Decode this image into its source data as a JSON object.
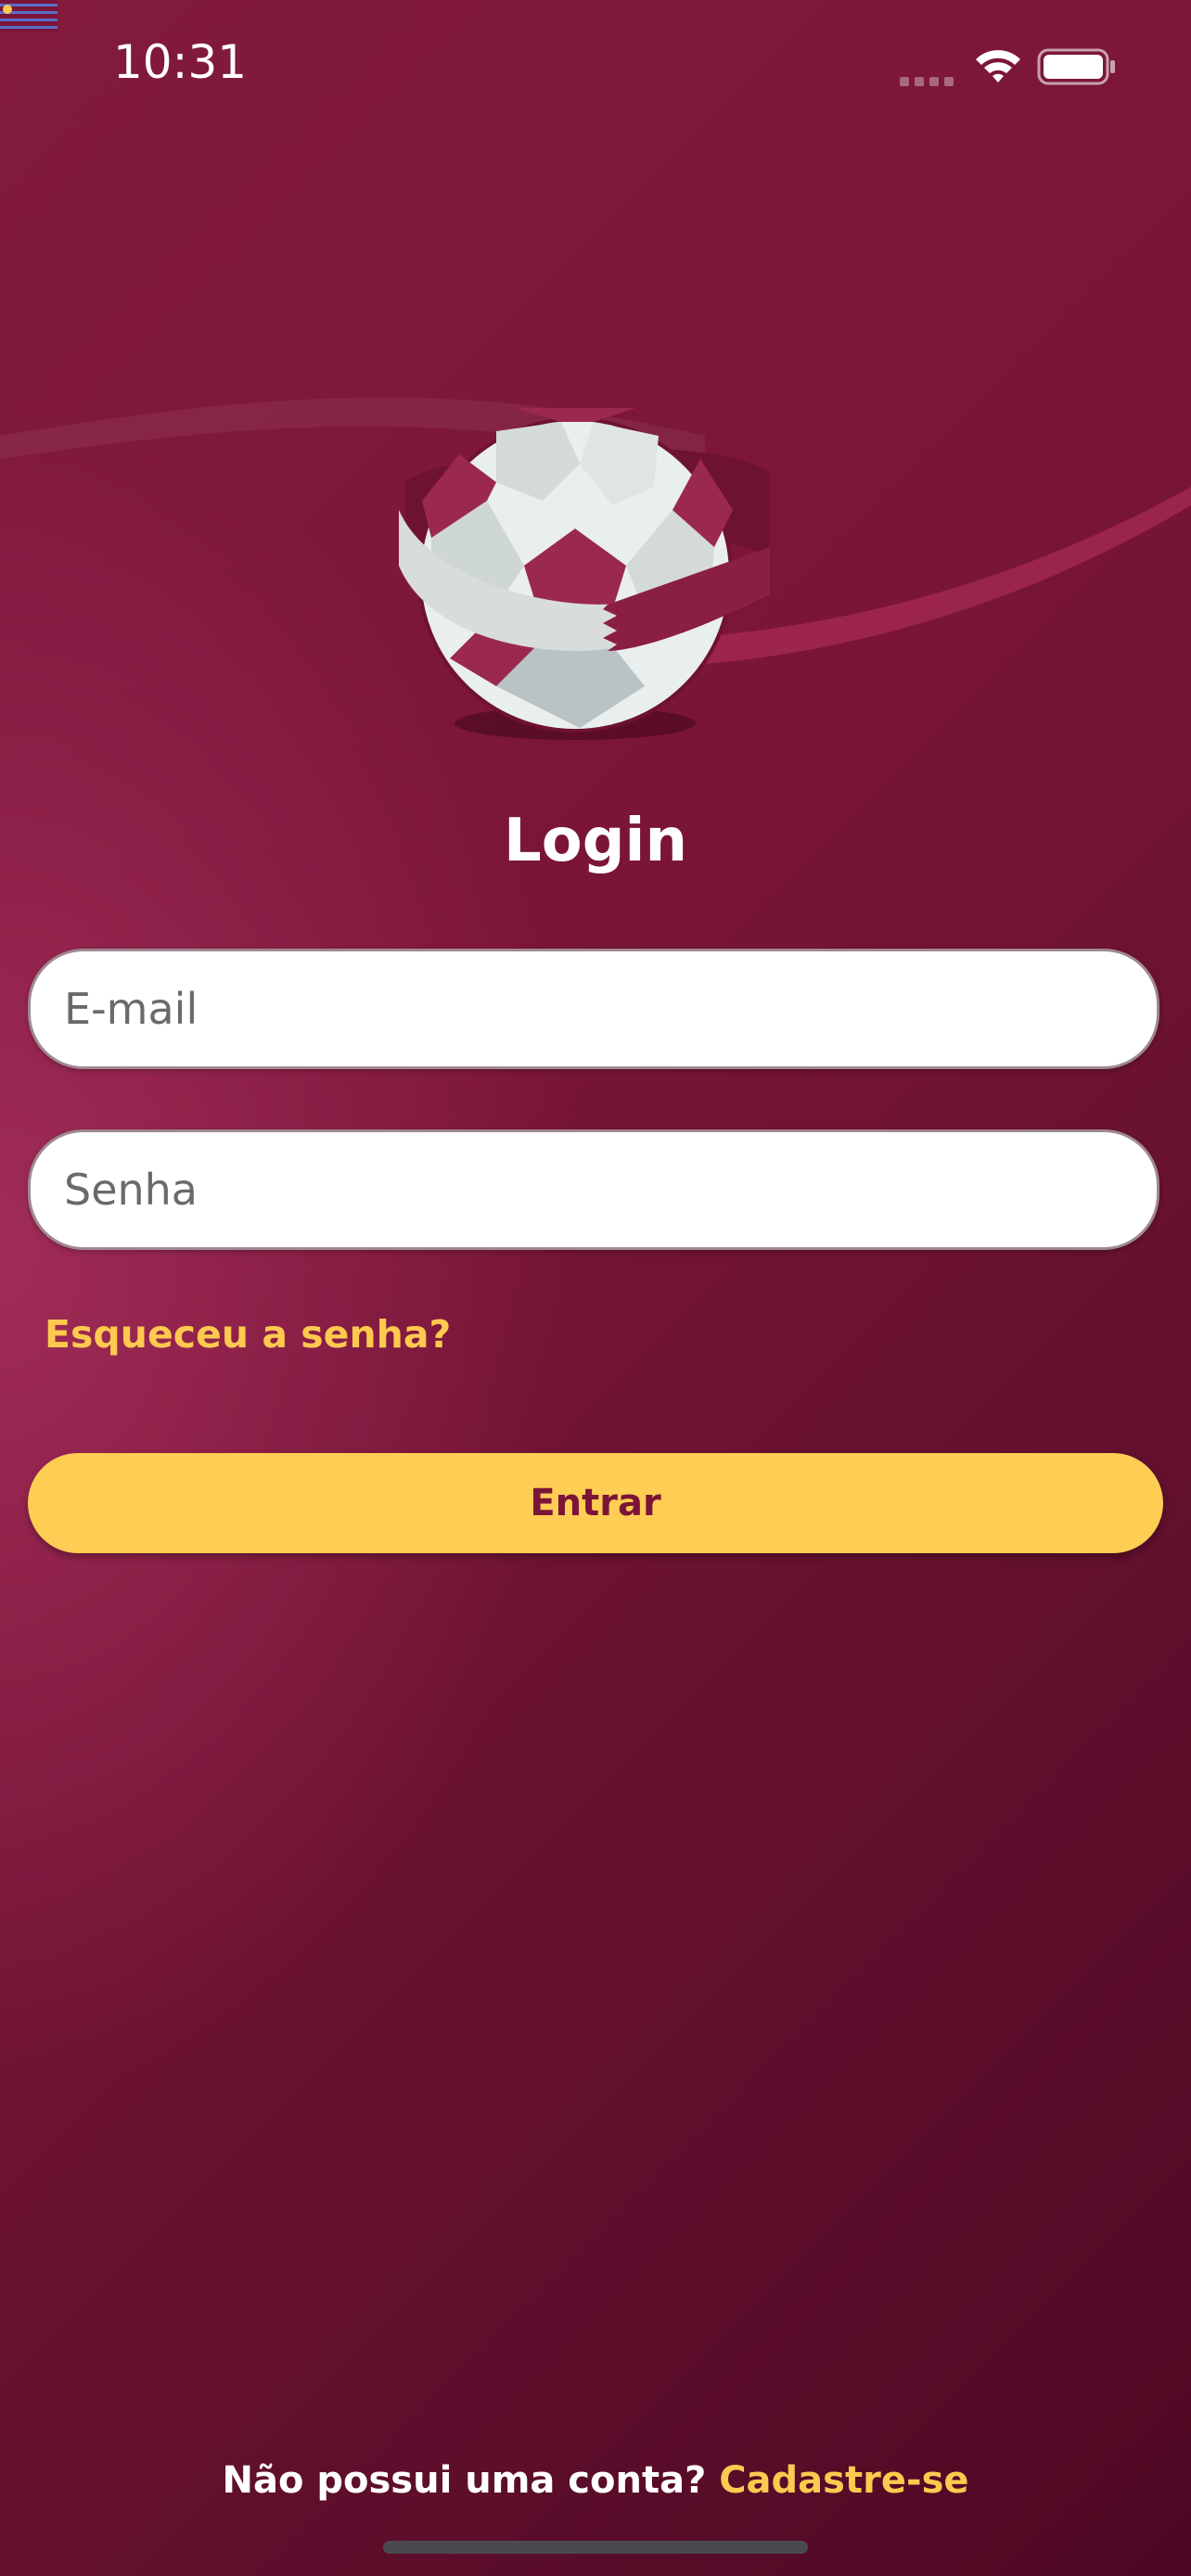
{
  "status_bar": {
    "time": "10:31",
    "icons": [
      "debug-flag-icon",
      "cellular-signal-icon",
      "wifi-icon",
      "battery-icon"
    ]
  },
  "logo": {
    "icon": "soccer-ball-icon"
  },
  "login": {
    "title": "Login",
    "email_placeholder": "E-mail",
    "email_value": "",
    "password_placeholder": "Senha",
    "password_value": "",
    "forgot_password_label": "Esqueceu a senha?",
    "submit_label": "Entrar"
  },
  "signup": {
    "prompt": "Não possui uma conta?",
    "link_label": "Cadastre-se"
  },
  "colors": {
    "background_dark": "#4e0823",
    "background_mid": "#7a1538",
    "accent": "#fecd53",
    "link": "#fec94f",
    "text": "#ffffff"
  }
}
